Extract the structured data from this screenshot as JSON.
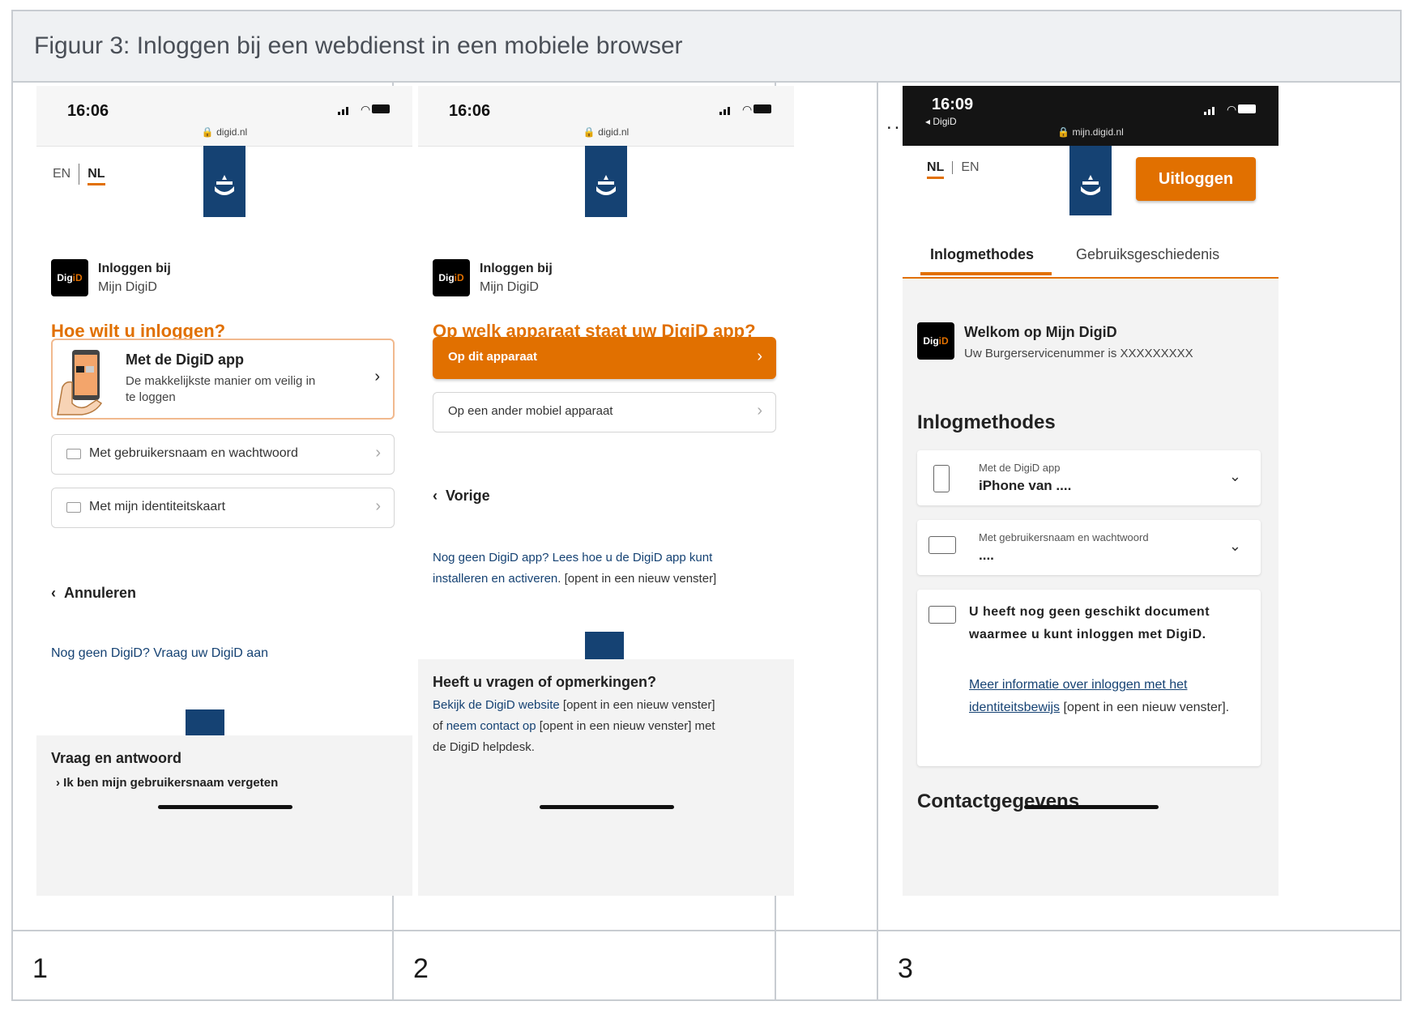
{
  "figure": {
    "title": "Figuur 3: Inloggen bij een webdienst in een mobiele browser",
    "captions": [
      "1",
      "2",
      "",
      "3"
    ],
    "ellipsis": "... ... ..."
  },
  "phone1": {
    "time": "16:06",
    "url": "digid.nl",
    "lang_inactive": "EN",
    "lang_active": "NL",
    "service_line1": "Inloggen bij",
    "service_line2": "Mijn DigiD",
    "badge_a": "Dig",
    "badge_b": "iD",
    "heading": "Hoe wilt u inloggen?",
    "options": [
      {
        "title": "Met de DigiD app",
        "desc_line1": "De makkelijkste manier om veilig in",
        "desc_line2": "te loggen"
      },
      {
        "title": "Met gebruikersnaam en wachtwoord"
      },
      {
        "title": "Met mijn identiteitskaart"
      }
    ],
    "cancel": "Annuleren",
    "no_digid_link": "Nog geen DigiD? Vraag uw DigiD aan",
    "faq_title": "Vraag en antwoord",
    "faq_item": "Ik ben mijn gebruikersnaam vergeten"
  },
  "phone2": {
    "time": "16:06",
    "url": "digid.nl",
    "service_line1": "Inloggen bij",
    "service_line2": "Mijn DigiD",
    "badge_a": "Dig",
    "badge_b": "iD",
    "heading": "Op welk apparaat staat uw DigiD app?",
    "primary_option": "Op dit apparaat",
    "secondary_option": "Op een ander mobiel apparaat",
    "back": "Vorige",
    "app_link_line1": "Nog geen DigiD app? Lees hoe u de DigiD app kunt",
    "app_link_line2": "installeren en activeren",
    "new_window_1": ". [opent in een nieuw venster]",
    "questions_title": "Heeft u vragen of opmerkingen?",
    "q_link1": "Bekijk de DigiD website",
    "q_text1": " [opent in een nieuw venster]",
    "q_text2": "of ",
    "q_link2": "neem contact op",
    "q_text3": " [opent in een nieuw venster] met",
    "q_text4": "de DigiD helpdesk."
  },
  "phone3": {
    "time": "16:09",
    "back_app": "◂ DigiD",
    "url": "mijn.digid.nl",
    "lang_active": "NL",
    "lang_inactive": "EN",
    "logout": "Uitloggen",
    "tab_active": "Inlogmethodes",
    "tab_other": "Gebruiksgeschiedenis",
    "welcome_title": "Welkom op Mijn DigiD",
    "welcome_sub": "Uw Burgerservicenummer is XXXXXXXXX",
    "badge_a": "Dig",
    "badge_b": "iD",
    "methods_title": "Inlogmethodes",
    "method1_label": "Met de DigiD app",
    "method1_value": "iPhone van ....",
    "method2_label": "Met gebruikersnaam en wachtwoord",
    "method2_value": "....",
    "notice_bold": "U heeft nog geen geschikt document waarmee u kunt inloggen met DigiD.",
    "notice_link": "Meer informatie over inloggen met het identiteitsbewijs",
    "notice_rest": " [opent in een nieuw venster].",
    "contact_title": "Contactgegevens"
  },
  "colors": {
    "accent_orange": "#e17000",
    "rijksoverheid_blue": "#154273",
    "link_blue": "#154273"
  }
}
